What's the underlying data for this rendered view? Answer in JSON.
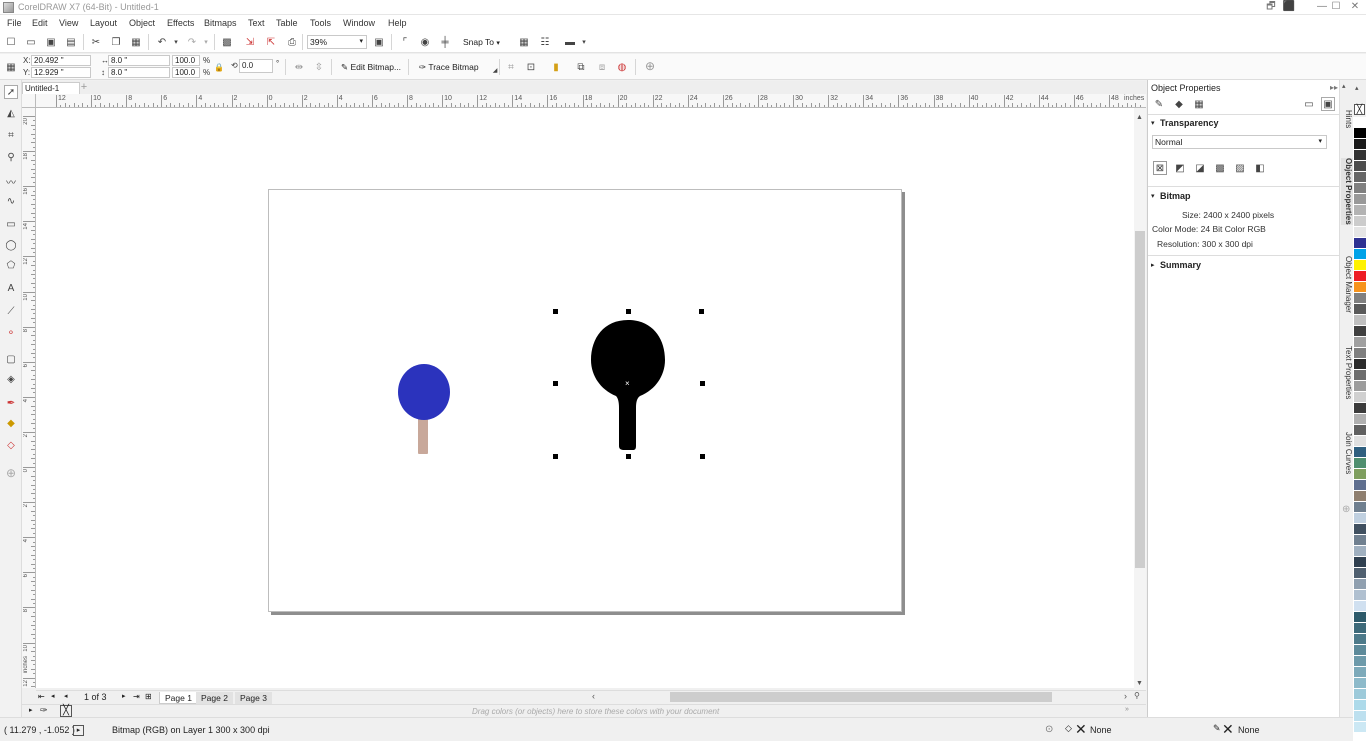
{
  "window": {
    "title": "CorelDRAW X7 (64-Bit) - Untitled-1",
    "controls": [
      "🗗",
      "⬛",
      "—",
      "☐",
      "✕"
    ]
  },
  "menubar": {
    "items": [
      "File",
      "Edit",
      "View",
      "Layout",
      "Object",
      "Effects",
      "Bitmaps",
      "Text",
      "Table",
      "Tools",
      "Window",
      "Help"
    ]
  },
  "standard_toolbar": {
    "zoom_value": "39%",
    "snap_to_label": "Snap To"
  },
  "property_bar": {
    "x_label": "X:",
    "x_value": "20.492 \"",
    "y_label": "Y:",
    "y_value": "12.929 \"",
    "width_value": "8.0 \"",
    "height_value": "8.0 \"",
    "scale_x": "100.0",
    "scale_y": "100.0",
    "percent_x": "%",
    "percent_y": "%",
    "rotation_value": "0.0",
    "rotation_unit": "°",
    "edit_bitmap_label": "Edit Bitmap...",
    "trace_bitmap_label": "Trace Bitmap"
  },
  "document_tab": {
    "name": "Untitled-1",
    "add_symbol": "+"
  },
  "rulers": {
    "unit_label": "inches",
    "h_ticks": [
      "12",
      "10",
      "8",
      "6",
      "4",
      "2",
      "0",
      "2",
      "4",
      "6",
      "8",
      "10",
      "12",
      "14",
      "16",
      "18",
      "20",
      "22",
      "24",
      "26",
      "28",
      "30",
      "32",
      "34",
      "36",
      "38",
      "40",
      "42",
      "44",
      "46",
      "48"
    ],
    "v_ticks": [
      "20",
      "18",
      "16",
      "14",
      "12",
      "10",
      "8",
      "6",
      "4",
      "2",
      "0",
      "2",
      "4",
      "6",
      "8",
      "10",
      "12"
    ],
    "v_unit_label": "inches"
  },
  "page_navigator": {
    "page_count_label": "1 of 3",
    "pages": [
      "Page 1",
      "Page 2",
      "Page 3"
    ],
    "active_page": "Page 1"
  },
  "color_dock": {
    "hint": "Drag colors (or objects) here to store these colors with your document"
  },
  "statusbar": {
    "cursor_position": "( 11.279 , -1.052 )",
    "object_info": "Bitmap (RGB) on Layer 1 300 x 300 dpi",
    "fill_label": "None",
    "outline_label": "None"
  },
  "object_properties": {
    "panel_title": "Object Properties",
    "transparency": {
      "header": "Transparency",
      "mode": "Normal"
    },
    "bitmap": {
      "header": "Bitmap",
      "size": "Size: 2400 x 2400 pixels",
      "color_mode": "Color Mode: 24 Bit Color  RGB",
      "resolution": "Resolution: 300 x 300 dpi"
    },
    "summary": {
      "header": "Summary"
    }
  },
  "docker_tabs": [
    "Hints",
    "Object Properties",
    "Object Manager",
    "Text Properties",
    "Join Curves"
  ],
  "canvas_objects": {
    "blue_paddle_color": "#2b33bd",
    "handle_color": "#c8a89a",
    "black_paddle_color": "#000000"
  },
  "palette_colors": [
    "#ffffff",
    "#000000",
    "#1a1a1a",
    "#333333",
    "#4d4d4d",
    "#666666",
    "#808080",
    "#999999",
    "#b3b3b3",
    "#cccccc",
    "#e5e5e5",
    "#2e3192",
    "#00a2e8",
    "#fff200",
    "#ed1c24",
    "#f7941d",
    "#808080",
    "#5a5a5a",
    "#c0c0c0",
    "#404040",
    "#a0a0a0",
    "#7f7f7f",
    "#2b2b2b",
    "#6d6d6d",
    "#9c9c9c",
    "#d0d0d0",
    "#3c3c3c",
    "#b0b0b0",
    "#606060",
    "#e0e0e0",
    "#2f5f7f",
    "#4f8f6f",
    "#7f9f5f",
    "#5f6f8f",
    "#8f7f6f",
    "#6f7f8f",
    "#c0d0e0",
    "#405060",
    "#708090",
    "#a0b0c0",
    "#304050",
    "#506070",
    "#90a0b0",
    "#b0c0d0",
    "#d0e0f0",
    "#2d5a6a",
    "#3d6a7a",
    "#4d7a8a",
    "#5d8a9a",
    "#6d9aaa",
    "#7daaba",
    "#8dbaca",
    "#9dcada",
    "#addaea",
    "#bde0ef",
    "#cce8f4"
  ]
}
